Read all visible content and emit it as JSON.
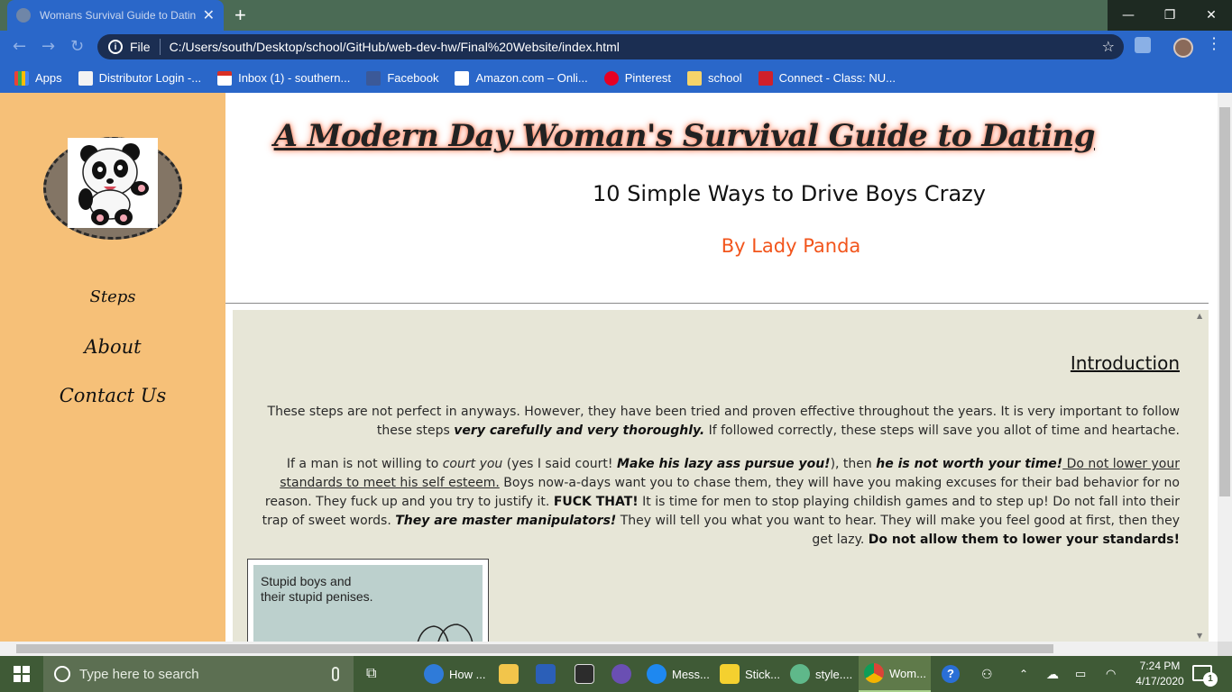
{
  "browser": {
    "tab_title": "Womans Survival Guide to Datin",
    "new_tab_label": "+",
    "file_label": "File",
    "url": "C:/Users/south/Desktop/school/GitHub/web-dev-hw/Final%20Website/index.html",
    "accent_color": "#2a67c9",
    "bookmarks": [
      {
        "label": "Apps",
        "icon": "apps-grid-icon"
      },
      {
        "label": "Distributor Login -...",
        "icon": "distributor-icon"
      },
      {
        "label": "Inbox (1) - southern...",
        "icon": "gmail-icon"
      },
      {
        "label": "Facebook",
        "icon": "facebook-icon"
      },
      {
        "label": "Amazon.com – Onli...",
        "icon": "amazon-icon"
      },
      {
        "label": "Pinterest",
        "icon": "pinterest-icon"
      },
      {
        "label": "school",
        "icon": "folder-icon"
      },
      {
        "label": "Connect - Class: NU...",
        "icon": "connect-icon"
      }
    ]
  },
  "page": {
    "sidebar_color": "#f6c078",
    "nav": [
      {
        "label": "Steps"
      },
      {
        "label": "About"
      },
      {
        "label": "Contact Us"
      }
    ],
    "title": "A Modern Day Woman's Survival Guide to Dating",
    "subtitle": "10 Simple Ways to Drive Boys Crazy",
    "author": "By Lady Panda",
    "author_color": "#f2551c",
    "intro": {
      "heading": "Introduction",
      "p1": {
        "a": "These steps are not perfect in anyways. However, they have been tried and proven effective throughout the years. It is very important to follow these steps ",
        "b": "very carefully and very thoroughly.",
        "c": " If followed correctly, these steps will save you allot of time and heartache."
      },
      "p2": {
        "a": "If a man is not willing to ",
        "b": "court you",
        "c": " (yes I said court! ",
        "d": "Make his lazy ass pursue you!",
        "e": "), then ",
        "f": "he is not worth your time!",
        "g": " Do not lower your standards to meet his self esteem.",
        "h": " Boys now-a-days want you to chase them, they will have you making excuses for their bad behavior for no reason. They fuck up and you try to justify it. ",
        "i": "FUCK THAT!",
        "j": " It is time for men to stop playing childish games and to step up! Do not fall into their trap of sweet words. ",
        "k": "They are master manipulators!",
        "l": " They will tell you what you want to hear. They will make you feel good at first, then they get lazy. ",
        "m": "Do not allow them to lower your standards!"
      },
      "meme_line1": "Stupid boys and",
      "meme_line2": "their stupid penises."
    }
  },
  "taskbar": {
    "search_placeholder": "Type here to search",
    "items": [
      {
        "label": "How ...",
        "icon": "edge-icon"
      },
      {
        "label": "",
        "icon": "file-explorer-icon"
      },
      {
        "label": "",
        "icon": "word-icon"
      },
      {
        "label": "",
        "icon": "calculator-icon"
      },
      {
        "label": "",
        "icon": "app-cat-icon"
      },
      {
        "label": "Mess...",
        "icon": "messenger-icon"
      },
      {
        "label": "Stick...",
        "icon": "sticky-notes-icon"
      },
      {
        "label": "style....",
        "icon": "atom-icon"
      },
      {
        "label": "Wom...",
        "icon": "chrome-icon"
      }
    ],
    "time": "7:24 PM",
    "date": "4/17/2020",
    "notification_count": "1"
  }
}
